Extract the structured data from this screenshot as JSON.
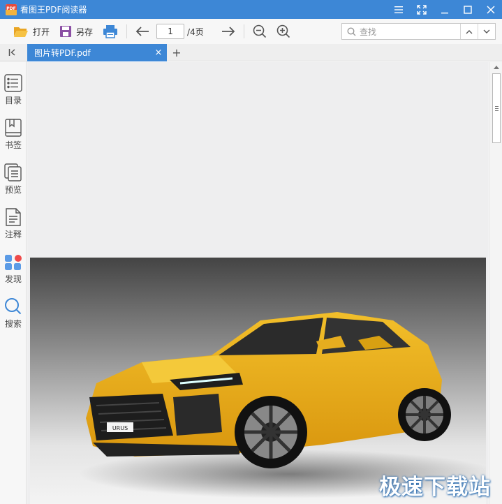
{
  "window": {
    "title": "看图王PDF阅读器",
    "logo_text": "PDF",
    "accent_color": "#3d87d6"
  },
  "toolbar": {
    "open_label": "打开",
    "save_as_label": "另存",
    "current_page": "1",
    "total_pages": "/4页",
    "search_placeholder": "查找"
  },
  "tabs": {
    "active_tab_label": "图片转PDF.pdf",
    "close_symbol": "×",
    "add_symbol": "+"
  },
  "sidebar": {
    "items": [
      {
        "label": "目录",
        "icon": "list-icon"
      },
      {
        "label": "书签",
        "icon": "bookmark-icon"
      },
      {
        "label": "预览",
        "icon": "preview-icon"
      },
      {
        "label": "注释",
        "icon": "annotation-icon"
      },
      {
        "label": "发现",
        "icon": "discover-icon"
      },
      {
        "label": "搜索",
        "icon": "search-icon"
      }
    ]
  },
  "document": {
    "car_plate_text": "URUS"
  },
  "watermark": {
    "text": "极速下载站"
  }
}
